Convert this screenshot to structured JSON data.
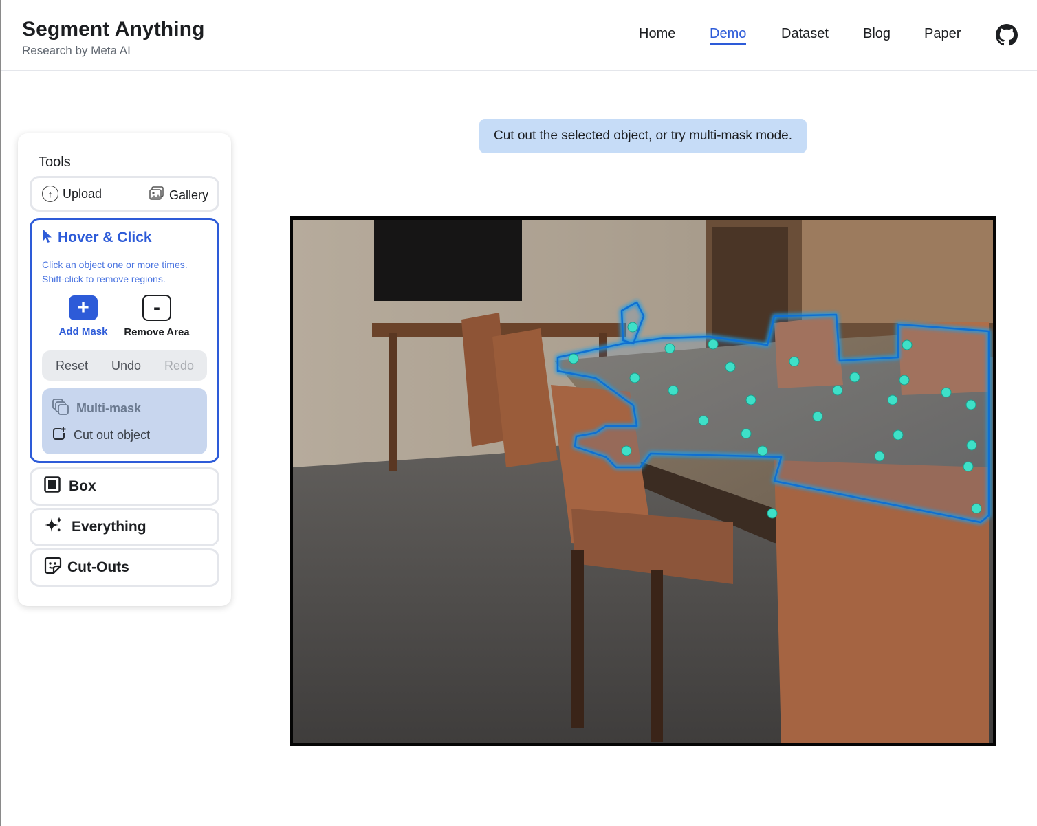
{
  "header": {
    "title": "Segment Anything",
    "subtitle": "Research by Meta AI",
    "nav": [
      {
        "label": "Home",
        "active": false
      },
      {
        "label": "Demo",
        "active": true
      },
      {
        "label": "Dataset",
        "active": false
      },
      {
        "label": "Blog",
        "active": false
      },
      {
        "label": "Paper",
        "active": false
      }
    ],
    "github_icon": "github-icon"
  },
  "tools": {
    "title": "Tools",
    "upload_label": "Upload",
    "gallery_label": "Gallery",
    "hover_click": {
      "title": "Hover & Click",
      "description_line1": "Click an object one or more times.",
      "description_line2": "Shift-click to remove regions.",
      "add_mask_label": "Add Mask",
      "remove_area_label": "Remove Area",
      "reset_label": "Reset",
      "undo_label": "Undo",
      "redo_label": "Redo",
      "multimask_label": "Multi-mask",
      "cutout_label": "Cut out object"
    },
    "box_label": "Box",
    "everything_label": "Everything",
    "cutouts_label": "Cut-Outs"
  },
  "toast": {
    "text": "Cut out the selected object, or try multi-mask mode."
  },
  "colors": {
    "accent": "#2d5bd8",
    "toast_bg": "#c6dcf7",
    "point": "#3ee0c8",
    "mask_outline": "#1e9be8"
  }
}
